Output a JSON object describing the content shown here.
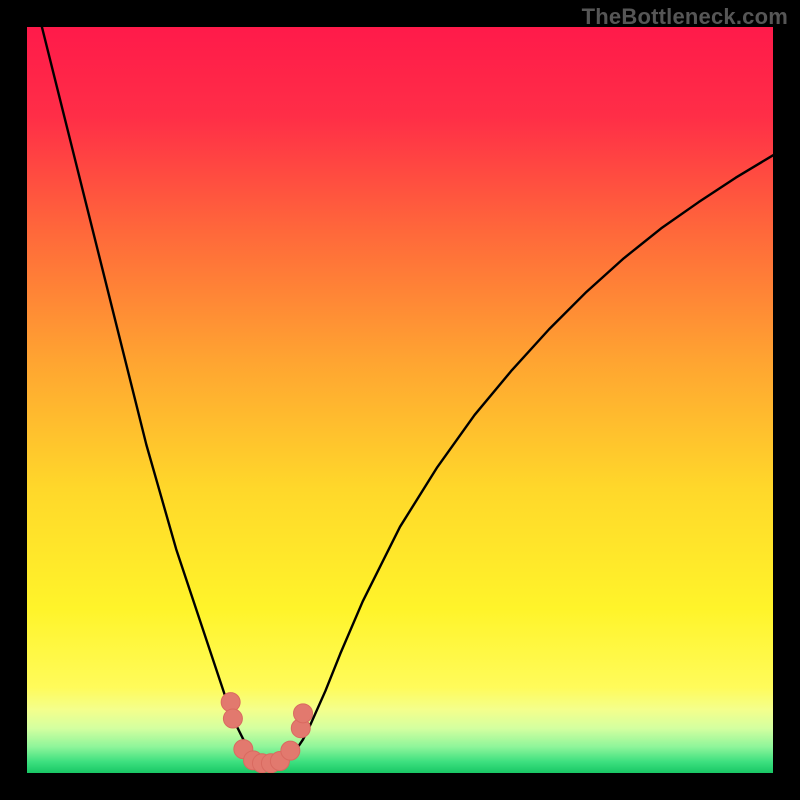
{
  "watermark": "TheBottleneck.com",
  "colors": {
    "gradient_stops": [
      {
        "offset": 0.0,
        "color": "#ff1a4a"
      },
      {
        "offset": 0.12,
        "color": "#ff2e47"
      },
      {
        "offset": 0.28,
        "color": "#ff6a3a"
      },
      {
        "offset": 0.45,
        "color": "#ffa531"
      },
      {
        "offset": 0.62,
        "color": "#ffd82a"
      },
      {
        "offset": 0.78,
        "color": "#fff42a"
      },
      {
        "offset": 0.885,
        "color": "#fffb5a"
      },
      {
        "offset": 0.915,
        "color": "#f4ff8c"
      },
      {
        "offset": 0.94,
        "color": "#d4ffa0"
      },
      {
        "offset": 0.965,
        "color": "#8ef59a"
      },
      {
        "offset": 0.985,
        "color": "#3de07f"
      },
      {
        "offset": 1.0,
        "color": "#18c765"
      }
    ],
    "curve_stroke": "#000000",
    "marker_fill": "#e2796e",
    "marker_stroke": "#d96a60"
  },
  "chart_data": {
    "type": "line",
    "title": "",
    "xlabel": "",
    "ylabel": "",
    "xlim": [
      0,
      100
    ],
    "ylim": [
      0,
      100
    ],
    "series": [
      {
        "name": "bottleneck-curve",
        "x": [
          0,
          2,
          4,
          6,
          8,
          10,
          12,
          14,
          16,
          18,
          20,
          22,
          24,
          26,
          27,
          28,
          29,
          30,
          31,
          32,
          33,
          34,
          35,
          36,
          37,
          38,
          40,
          42,
          45,
          50,
          55,
          60,
          65,
          70,
          75,
          80,
          85,
          90,
          95,
          100
        ],
        "y": [
          108,
          100,
          92,
          84,
          76,
          68,
          60,
          52,
          44,
          37,
          30,
          24,
          18,
          12,
          9,
          6.5,
          4.5,
          3,
          2,
          1.4,
          1.2,
          1.4,
          2,
          3,
          4.5,
          6.5,
          11,
          16,
          23,
          33,
          41,
          48,
          54,
          59.5,
          64.5,
          69,
          73,
          76.5,
          79.8,
          82.8
        ]
      }
    ],
    "markers": {
      "name": "highlighted-points",
      "points": [
        {
          "x": 27.3,
          "y": 9.5
        },
        {
          "x": 27.6,
          "y": 7.3
        },
        {
          "x": 29.0,
          "y": 3.2
        },
        {
          "x": 30.3,
          "y": 1.7
        },
        {
          "x": 31.5,
          "y": 1.3
        },
        {
          "x": 32.7,
          "y": 1.3
        },
        {
          "x": 33.9,
          "y": 1.6
        },
        {
          "x": 35.3,
          "y": 3.0
        },
        {
          "x": 36.7,
          "y": 6.0
        },
        {
          "x": 37.0,
          "y": 8.0
        }
      ]
    }
  }
}
